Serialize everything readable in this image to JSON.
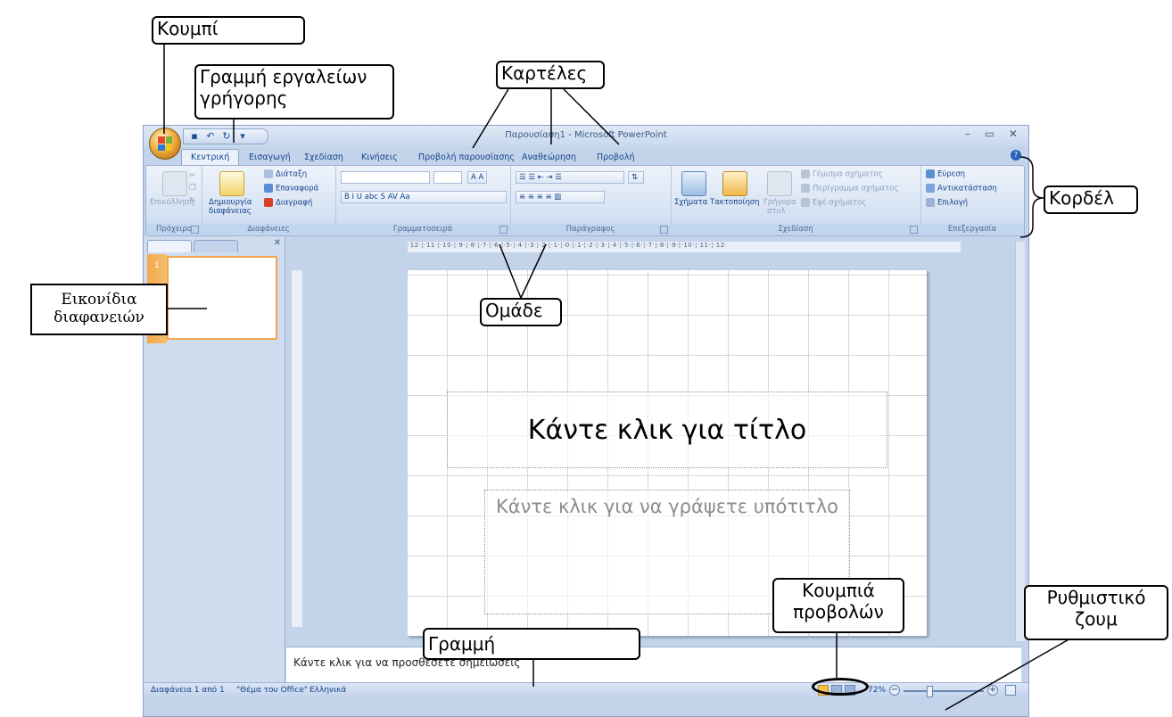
{
  "window": {
    "title": "Παρουσίαση1 - Microsoft PowerPoint",
    "controls": "– ▭ ✕"
  },
  "tabs": [
    "Κεντρική",
    "Εισαγωγή",
    "Σχεδίαση",
    "Κινήσεις",
    "Προβολή παρουσίασης",
    "Αναθεώρηση",
    "Προβολή"
  ],
  "ribbon": {
    "clipboard": {
      "name": "Πρόχειρο",
      "paste": "Επικόλληση"
    },
    "slides": {
      "name": "Διαφάνειες",
      "new_slide": "Δημιουργία",
      "new_slide2": "διαφάνειας",
      "layout": "Διάταξη",
      "reset": "Επαναφορά",
      "delete": "Διαγραφή"
    },
    "font": {
      "name": "Γραμματοσειρά",
      "buttons": "B  I  U  abc  S  AV  Aa",
      "grow": "A  A"
    },
    "paragraph": {
      "name": "Παράγραφος"
    },
    "drawing": {
      "name": "Σχεδίαση",
      "shapes": "Σχήματα",
      "arrange": "Τακτοποίηση",
      "quick1": "Γρήγορα",
      "quick2": "στυλ",
      "fill": "Γέμισμα σχήματος",
      "outline": "Περίγραμμα σχήματος",
      "effects": "Εφέ σχήματος"
    },
    "editing": {
      "name": "Επεξεργασία",
      "find": "Εύρεση",
      "replace": "Αντικατάσταση",
      "select": "Επιλογή"
    }
  },
  "ruler_text": "·12·¦·11·¦·10·¦·9·¦·8·¦·7·¦·6·¦·5·¦·4·¦·3·¦·2·¦·1·¦·0·¦·1·¦·2·¦·3·¦·4·¦·5·¦·6·¦·7·¦·8·¦·9·¦·10·¦·11·¦·12·",
  "slide": {
    "number": "1",
    "title_placeholder": "Κάντε κλικ για τίτλο",
    "subtitle_placeholder": "Κάντε κλικ για να γράψετε υπότιτλο"
  },
  "notes_placeholder": "Κάντε κλικ για να προσθέσετε σημειώσεις",
  "status": {
    "slide_of": "Διαφάνεια 1 από 1",
    "theme": "\"Θέμα του Office\"",
    "language": "Ελληνικά",
    "zoom": "72%",
    "zoom_fraction": 0.32
  },
  "callouts": {
    "button": "Κουμπί",
    "qat1": "Γραμμή εργαλείων",
    "qat2": "γρήγορης",
    "tabs": "Καρτέλες",
    "ribbon": "Κορδέλ",
    "thumbs1": "Εικονίδια",
    "thumbs2": "διαφανειών",
    "groups": "Ομάδε",
    "views1": "Κουμπιά",
    "views2": "προβολών",
    "zoom1": "Ρυθμιστικό",
    "zoom2": "ζουμ",
    "bar": "Γραμμή"
  }
}
